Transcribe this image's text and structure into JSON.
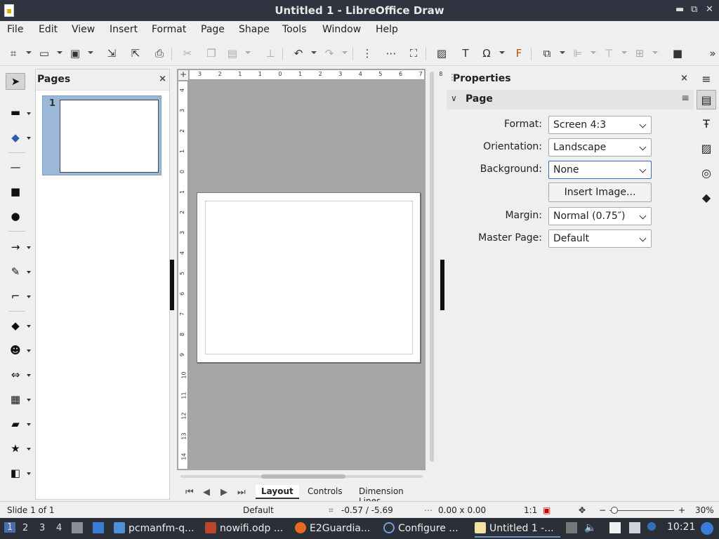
{
  "window": {
    "title": "Untitled 1 - LibreOffice Draw",
    "minimize": "▬",
    "maximize": "⧉",
    "close": "✕"
  },
  "menu": [
    "File",
    "Edit",
    "View",
    "Insert",
    "Format",
    "Page",
    "Shape",
    "Tools",
    "Window",
    "Help"
  ],
  "toolbar": {
    "overflow": "»"
  },
  "pages_panel": {
    "title": "Pages",
    "close": "×",
    "thumbs": [
      {
        "num": "1"
      }
    ]
  },
  "rulers": {
    "horizontal": [
      "3",
      "2",
      "1",
      "1",
      "0",
      "1",
      "2",
      "3",
      "4",
      "5",
      "6",
      "7",
      "8"
    ],
    "vertical": [
      "4",
      "3",
      "2",
      "1",
      "0",
      "1",
      "2",
      "3",
      "4",
      "5",
      "6",
      "7",
      "8",
      "9",
      "10",
      "11",
      "12",
      "13",
      "14"
    ]
  },
  "tabs": {
    "items": [
      "Layout",
      "Controls",
      "Dimension Lines"
    ],
    "active": 0
  },
  "properties": {
    "title": "Properties",
    "close": "×",
    "section": "Page",
    "fields": [
      {
        "label": "Format:",
        "value": "Screen 4:3"
      },
      {
        "label": "Orientation:",
        "value": "Landscape"
      },
      {
        "label": "Background:",
        "value": "None"
      },
      {
        "label": "Margin:",
        "value": "Normal (0.75″)"
      },
      {
        "label": "Master Page:",
        "value": "Default"
      }
    ],
    "insert_image": "Insert Image..."
  },
  "status": {
    "slide": "Slide 1 of 1",
    "master": "Default",
    "position": "-0.57 / -5.69",
    "size": "0.00 x 0.00",
    "scale": "1:1",
    "zoom": "30%",
    "zoom_minus": "−",
    "zoom_plus": "+"
  },
  "taskbar": {
    "workspaces": [
      "1",
      "2",
      "3",
      "4"
    ],
    "tasks": [
      "pcmanfm-q...",
      "nowifi.odp ...",
      "E2Guardia...",
      "Configure ...",
      "Untitled 1 -..."
    ],
    "clock": "10:21"
  },
  "colors": {
    "accent": "#3a6fb5",
    "titlebar": "#2f3440",
    "taskbar": "#2b2f38",
    "thumb_selected": "#9cb8d8"
  }
}
